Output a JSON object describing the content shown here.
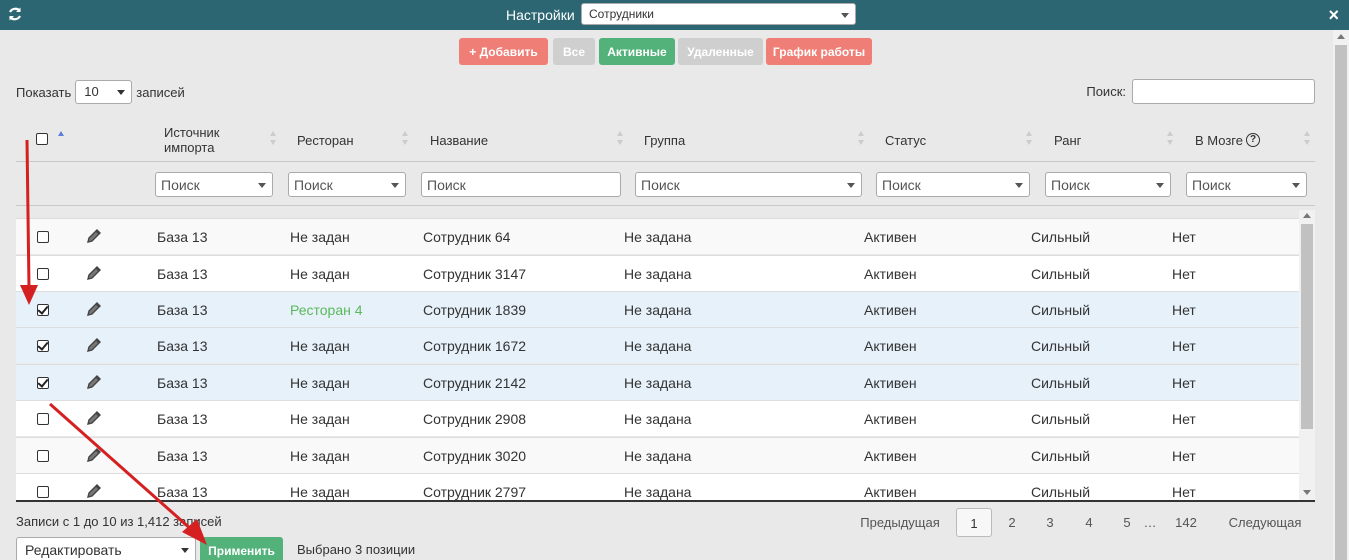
{
  "titlebar": {
    "title": "Настройки",
    "select_value": "Сотрудники",
    "close": "×"
  },
  "buttons": {
    "add": "+ Добавить",
    "all": "Все",
    "active": "Активные",
    "deleted": "Удаленные",
    "schedule": "График работы"
  },
  "length": {
    "prefix": "Показать",
    "value": "10",
    "suffix": "записей"
  },
  "search": {
    "label": "Поиск:",
    "value": ""
  },
  "columns": {
    "source": "Источник импорта",
    "restaurant": "Ресторан",
    "name": "Название",
    "group": "Группа",
    "status": "Статус",
    "rank": "Ранг",
    "brain": "В Мозге",
    "help": "?"
  },
  "filters": {
    "source": "Поиск",
    "restaurant": "Поиск",
    "name": "Поиск",
    "group": "Поиск",
    "status": "Поиск",
    "rank": "Поиск",
    "brain": "Поиск"
  },
  "rows": [
    {
      "checked": false,
      "source": "База 13",
      "restaurant": "Не задан",
      "name": "Сотрудник 64",
      "group": "Не задана",
      "status": "Активен",
      "rank": "Сильный",
      "brain": "Нет"
    },
    {
      "checked": false,
      "source": "База 13",
      "restaurant": "Не задан",
      "name": "Сотрудник 3147",
      "group": "Не задана",
      "status": "Активен",
      "rank": "Сильный",
      "brain": "Нет"
    },
    {
      "checked": true,
      "source": "База 13",
      "restaurant": "Ресторан 4",
      "name": "Сотрудник 1839",
      "group": "Не задана",
      "status": "Активен",
      "rank": "Сильный",
      "brain": "Нет"
    },
    {
      "checked": true,
      "source": "База 13",
      "restaurant": "Не задан",
      "name": "Сотрудник 1672",
      "group": "Не задана",
      "status": "Активен",
      "rank": "Сильный",
      "brain": "Нет"
    },
    {
      "checked": true,
      "source": "База 13",
      "restaurant": "Не задан",
      "name": "Сотрудник 2142",
      "group": "Не задана",
      "status": "Активен",
      "rank": "Сильный",
      "brain": "Нет"
    },
    {
      "checked": false,
      "source": "База 13",
      "restaurant": "Не задан",
      "name": "Сотрудник 2908",
      "group": "Не задана",
      "status": "Активен",
      "rank": "Сильный",
      "brain": "Нет"
    },
    {
      "checked": false,
      "source": "База 13",
      "restaurant": "Не задан",
      "name": "Сотрудник 3020",
      "group": "Не задана",
      "status": "Активен",
      "rank": "Сильный",
      "brain": "Нет"
    },
    {
      "checked": false,
      "source": "База 13",
      "restaurant": "Не задан",
      "name": "Сотрудник 2797",
      "group": "Не задана",
      "status": "Активен",
      "rank": "Сильный",
      "brain": "Нет"
    }
  ],
  "info": "Записи с 1 до 10 из 1,412 записей",
  "pager": {
    "prev": "Предыдущая",
    "pages": [
      "1",
      "2",
      "3",
      "4",
      "5",
      "…",
      "142"
    ],
    "current": "1",
    "next": "Следующая"
  },
  "bulk": {
    "action": "Редактировать",
    "apply": "Применить",
    "selected": "Выбрано 3 позиции"
  },
  "colors": {
    "titlebar": "#2c6673",
    "red": "#ef7f76",
    "green": "#52b27a",
    "gray": "#cfcfcf",
    "arrow": "#d42020",
    "link": "#5cb85c"
  }
}
